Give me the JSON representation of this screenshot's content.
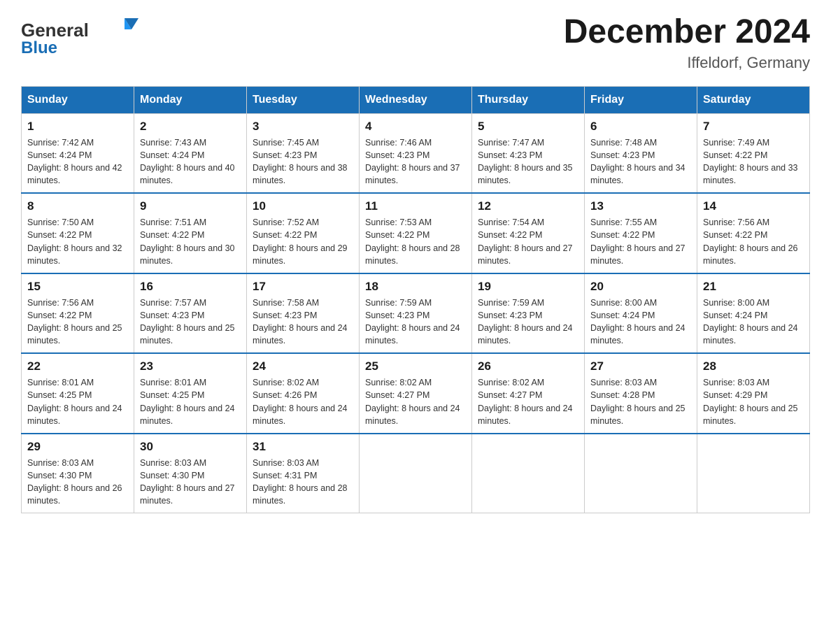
{
  "header": {
    "logo_general": "General",
    "logo_blue": "Blue",
    "title": "December 2024",
    "location": "Iffeldorf, Germany"
  },
  "columns": [
    "Sunday",
    "Monday",
    "Tuesday",
    "Wednesday",
    "Thursday",
    "Friday",
    "Saturday"
  ],
  "weeks": [
    [
      {
        "day": "1",
        "sunrise": "7:42 AM",
        "sunset": "4:24 PM",
        "daylight": "8 hours and 42 minutes."
      },
      {
        "day": "2",
        "sunrise": "7:43 AM",
        "sunset": "4:24 PM",
        "daylight": "8 hours and 40 minutes."
      },
      {
        "day": "3",
        "sunrise": "7:45 AM",
        "sunset": "4:23 PM",
        "daylight": "8 hours and 38 minutes."
      },
      {
        "day": "4",
        "sunrise": "7:46 AM",
        "sunset": "4:23 PM",
        "daylight": "8 hours and 37 minutes."
      },
      {
        "day": "5",
        "sunrise": "7:47 AM",
        "sunset": "4:23 PM",
        "daylight": "8 hours and 35 minutes."
      },
      {
        "day": "6",
        "sunrise": "7:48 AM",
        "sunset": "4:23 PM",
        "daylight": "8 hours and 34 minutes."
      },
      {
        "day": "7",
        "sunrise": "7:49 AM",
        "sunset": "4:22 PM",
        "daylight": "8 hours and 33 minutes."
      }
    ],
    [
      {
        "day": "8",
        "sunrise": "7:50 AM",
        "sunset": "4:22 PM",
        "daylight": "8 hours and 32 minutes."
      },
      {
        "day": "9",
        "sunrise": "7:51 AM",
        "sunset": "4:22 PM",
        "daylight": "8 hours and 30 minutes."
      },
      {
        "day": "10",
        "sunrise": "7:52 AM",
        "sunset": "4:22 PM",
        "daylight": "8 hours and 29 minutes."
      },
      {
        "day": "11",
        "sunrise": "7:53 AM",
        "sunset": "4:22 PM",
        "daylight": "8 hours and 28 minutes."
      },
      {
        "day": "12",
        "sunrise": "7:54 AM",
        "sunset": "4:22 PM",
        "daylight": "8 hours and 27 minutes."
      },
      {
        "day": "13",
        "sunrise": "7:55 AM",
        "sunset": "4:22 PM",
        "daylight": "8 hours and 27 minutes."
      },
      {
        "day": "14",
        "sunrise": "7:56 AM",
        "sunset": "4:22 PM",
        "daylight": "8 hours and 26 minutes."
      }
    ],
    [
      {
        "day": "15",
        "sunrise": "7:56 AM",
        "sunset": "4:22 PM",
        "daylight": "8 hours and 25 minutes."
      },
      {
        "day": "16",
        "sunrise": "7:57 AM",
        "sunset": "4:23 PM",
        "daylight": "8 hours and 25 minutes."
      },
      {
        "day": "17",
        "sunrise": "7:58 AM",
        "sunset": "4:23 PM",
        "daylight": "8 hours and 24 minutes."
      },
      {
        "day": "18",
        "sunrise": "7:59 AM",
        "sunset": "4:23 PM",
        "daylight": "8 hours and 24 minutes."
      },
      {
        "day": "19",
        "sunrise": "7:59 AM",
        "sunset": "4:23 PM",
        "daylight": "8 hours and 24 minutes."
      },
      {
        "day": "20",
        "sunrise": "8:00 AM",
        "sunset": "4:24 PM",
        "daylight": "8 hours and 24 minutes."
      },
      {
        "day": "21",
        "sunrise": "8:00 AM",
        "sunset": "4:24 PM",
        "daylight": "8 hours and 24 minutes."
      }
    ],
    [
      {
        "day": "22",
        "sunrise": "8:01 AM",
        "sunset": "4:25 PM",
        "daylight": "8 hours and 24 minutes."
      },
      {
        "day": "23",
        "sunrise": "8:01 AM",
        "sunset": "4:25 PM",
        "daylight": "8 hours and 24 minutes."
      },
      {
        "day": "24",
        "sunrise": "8:02 AM",
        "sunset": "4:26 PM",
        "daylight": "8 hours and 24 minutes."
      },
      {
        "day": "25",
        "sunrise": "8:02 AM",
        "sunset": "4:27 PM",
        "daylight": "8 hours and 24 minutes."
      },
      {
        "day": "26",
        "sunrise": "8:02 AM",
        "sunset": "4:27 PM",
        "daylight": "8 hours and 24 minutes."
      },
      {
        "day": "27",
        "sunrise": "8:03 AM",
        "sunset": "4:28 PM",
        "daylight": "8 hours and 25 minutes."
      },
      {
        "day": "28",
        "sunrise": "8:03 AM",
        "sunset": "4:29 PM",
        "daylight": "8 hours and 25 minutes."
      }
    ],
    [
      {
        "day": "29",
        "sunrise": "8:03 AM",
        "sunset": "4:30 PM",
        "daylight": "8 hours and 26 minutes."
      },
      {
        "day": "30",
        "sunrise": "8:03 AM",
        "sunset": "4:30 PM",
        "daylight": "8 hours and 27 minutes."
      },
      {
        "day": "31",
        "sunrise": "8:03 AM",
        "sunset": "4:31 PM",
        "daylight": "8 hours and 28 minutes."
      },
      null,
      null,
      null,
      null
    ]
  ]
}
